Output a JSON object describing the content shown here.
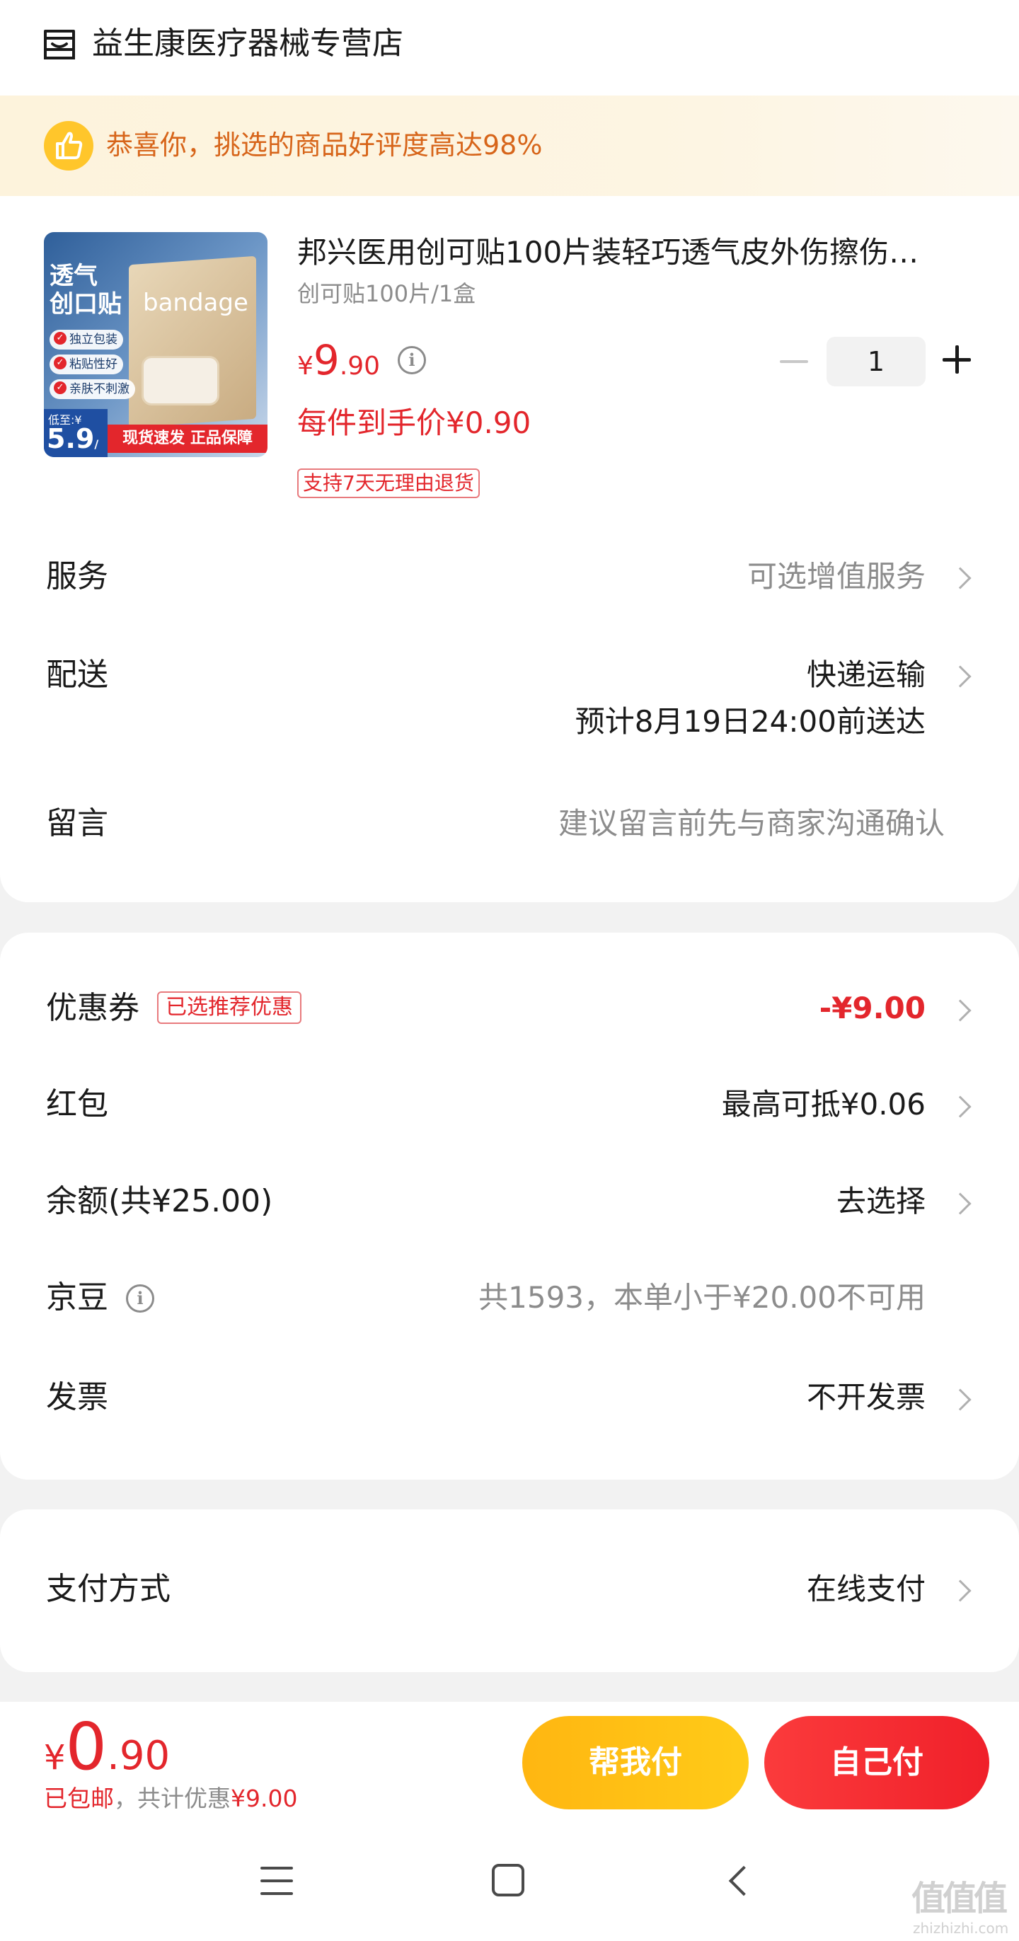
{
  "shop": {
    "name": "益生康医疗器械专营店",
    "icon": "store-icon"
  },
  "banner": {
    "text": "恭喜你，挑选的商品好评度高达98%",
    "icon": "thumbs-up-icon"
  },
  "product": {
    "title": "邦兴医用创可贴100片装轻巧透气皮外伤擦伤…",
    "spec": "创可贴100片/1盒",
    "price_currency": "¥",
    "price_int": "9",
    "price_dec": ".90",
    "each_price": "每件到手价¥0.90",
    "return_policy": "支持7天无理由退货",
    "quantity": "1",
    "image": {
      "title_line1": "透气",
      "title_line2": "创口贴",
      "brand": "bandage",
      "tags": [
        "独立包装",
        "粘贴性好",
        "亲肤不刺激"
      ],
      "price_label": "低至:¥",
      "price_value": "5.9",
      "price_unit": "/盒",
      "ribbon": "现货速发 正品保障"
    }
  },
  "order_rows": {
    "service": {
      "label": "服务",
      "value": "可选增值服务"
    },
    "delivery": {
      "label": "配送",
      "value": "快递运输",
      "eta": "预计8月19日24:00前送达"
    },
    "message": {
      "label": "留言",
      "placeholder": "建议留言前先与商家沟通确认"
    }
  },
  "discount_rows": {
    "coupon": {
      "label": "优惠券",
      "tag": "已选推荐优惠",
      "value": "-¥9.00"
    },
    "red_packet": {
      "label": "红包",
      "value": "最高可抵¥0.06"
    },
    "balance": {
      "label": "余额(共¥25.00)",
      "value": "去选择"
    },
    "jingdou": {
      "label": "京豆",
      "value": "共1593，本单小于¥20.00不可用"
    },
    "invoice": {
      "label": "发票",
      "value": "不开发票"
    }
  },
  "payment": {
    "label": "支付方式",
    "value": "在线支付"
  },
  "bottom": {
    "total_currency": "¥",
    "total_int": "0",
    "total_dec": ".90",
    "shipping": "已包邮",
    "discount_note": "，共计优惠",
    "discount_amount": "¥9.00",
    "helper_button": "帮我付",
    "self_button": "自己付"
  },
  "watermark": {
    "main": "值值值",
    "sub": "zhizhizhi.com"
  },
  "colors": {
    "accent_red": "#e3262c",
    "accent_yellow": "#ffc62b",
    "banner_bg": "#fdf3dc",
    "banner_text": "#d7651a"
  }
}
